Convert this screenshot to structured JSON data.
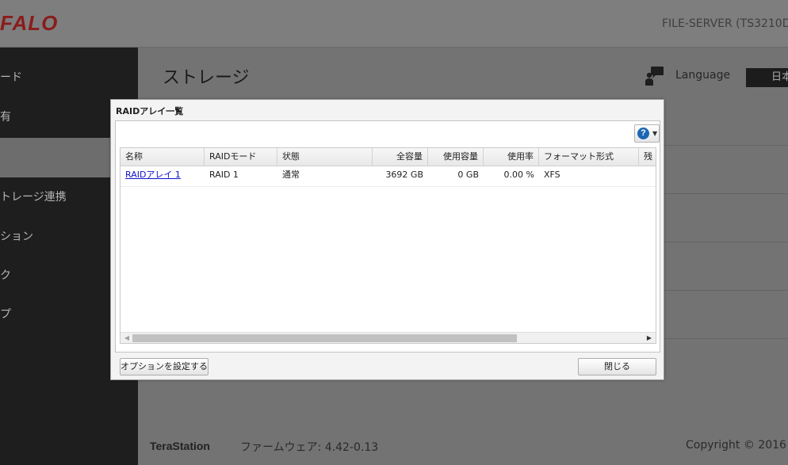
{
  "header": {
    "logo_text": "FALO",
    "server_name": "FILE-SERVER (TS3210D"
  },
  "sidebar": {
    "items": [
      {
        "label": "ード",
        "active": false
      },
      {
        "label": "有",
        "active": false
      },
      {
        "label": "",
        "active": true
      },
      {
        "label": "トレージ連携",
        "active": false
      },
      {
        "label": "ション",
        "active": false
      },
      {
        "label": "ク",
        "active": false
      },
      {
        "label": "プ",
        "active": false
      }
    ]
  },
  "page": {
    "title": "ストレージ",
    "language_label": "Language",
    "language_value": "日本"
  },
  "footer": {
    "brand": "TeraStation",
    "firmware": "ファームウェア: 4.42-0.13",
    "copyright": "Copyright © 2016"
  },
  "dialog": {
    "title": "RAIDアレイ一覧",
    "help_symbol": "?",
    "columns": [
      "名称",
      "RAIDモード",
      "状態",
      "全容量",
      "使用容量",
      "使用率",
      "フォーマット形式",
      "残"
    ],
    "rows": [
      {
        "name": "RAIDアレイ 1",
        "mode": "RAID 1",
        "status": "通常",
        "total": "3692 GB",
        "used": "0 GB",
        "usage": "0.00 %",
        "format": "XFS",
        "rest": ""
      }
    ],
    "options_button": "オプションを設定する",
    "close_button": "閉じる"
  },
  "colors": {
    "logo": "#8a1c1c",
    "link": "#1010cc",
    "help_icon": "#1b66b3",
    "sidebar_bg": "#1e1e1e"
  }
}
